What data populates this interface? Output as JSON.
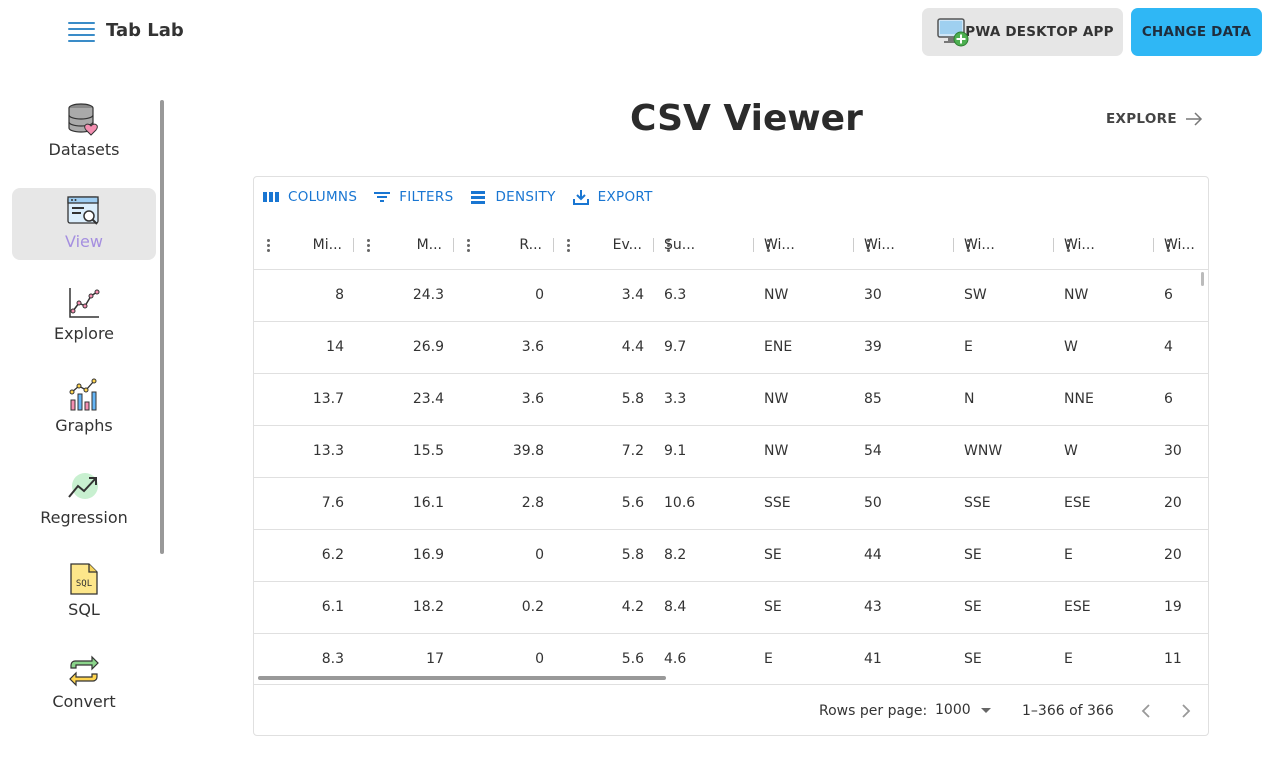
{
  "header": {
    "app_title": "Tab Lab",
    "pwa_button": "PWA DESKTOP APP",
    "change_button": "CHANGE DATA",
    "change_button_color": "#2fb7f5"
  },
  "sidebar": {
    "items": [
      {
        "label": "Datasets",
        "icon": "database-heart-icon"
      },
      {
        "label": "View",
        "icon": "browser-search-icon",
        "active": true
      },
      {
        "label": "Explore",
        "icon": "line-chart-icon"
      },
      {
        "label": "Graphs",
        "icon": "bar-line-chart-icon"
      },
      {
        "label": "Regression",
        "icon": "trend-up-icon"
      },
      {
        "label": "SQL",
        "icon": "sql-file-icon"
      },
      {
        "label": "Convert",
        "icon": "convert-arrows-icon"
      }
    ],
    "active_color": "#a58fe0"
  },
  "main": {
    "title": "CSV Viewer",
    "explore_link": "EXPLORE"
  },
  "grid": {
    "toolbar": {
      "columns": "COLUMNS",
      "filters": "FILTERS",
      "density": "DENSITY",
      "export": "EXPORT",
      "accent_color": "#1976d2"
    },
    "columns": [
      {
        "header": "Mi...",
        "align": "num"
      },
      {
        "header": "M...",
        "align": "num"
      },
      {
        "header": "R...",
        "align": "num"
      },
      {
        "header": "Ev...",
        "align": "num"
      },
      {
        "header": "Su...",
        "align": "txt"
      },
      {
        "header": "Wi...",
        "align": "txt"
      },
      {
        "header": "Wi...",
        "align": "txt"
      },
      {
        "header": "Wi...",
        "align": "txt"
      },
      {
        "header": "Wi...",
        "align": "txt"
      },
      {
        "header": "Wi...",
        "align": "txt"
      }
    ],
    "rows": [
      [
        "8",
        "24.3",
        "0",
        "3.4",
        "6.3",
        "NW",
        "30",
        "SW",
        "NW",
        "6"
      ],
      [
        "14",
        "26.9",
        "3.6",
        "4.4",
        "9.7",
        "ENE",
        "39",
        "E",
        "W",
        "4"
      ],
      [
        "13.7",
        "23.4",
        "3.6",
        "5.8",
        "3.3",
        "NW",
        "85",
        "N",
        "NNE",
        "6"
      ],
      [
        "13.3",
        "15.5",
        "39.8",
        "7.2",
        "9.1",
        "NW",
        "54",
        "WNW",
        "W",
        "30"
      ],
      [
        "7.6",
        "16.1",
        "2.8",
        "5.6",
        "10.6",
        "SSE",
        "50",
        "SSE",
        "ESE",
        "20"
      ],
      [
        "6.2",
        "16.9",
        "0",
        "5.8",
        "8.2",
        "SE",
        "44",
        "SE",
        "E",
        "20"
      ],
      [
        "6.1",
        "18.2",
        "0.2",
        "4.2",
        "8.4",
        "SE",
        "43",
        "SE",
        "ESE",
        "19"
      ],
      [
        "8.3",
        "17",
        "0",
        "5.6",
        "4.6",
        "E",
        "41",
        "SE",
        "E",
        "11"
      ]
    ],
    "footer": {
      "rows_per_page_label": "Rows per page:",
      "rows_per_page_value": "1000",
      "range": "1–366 of 366"
    }
  }
}
